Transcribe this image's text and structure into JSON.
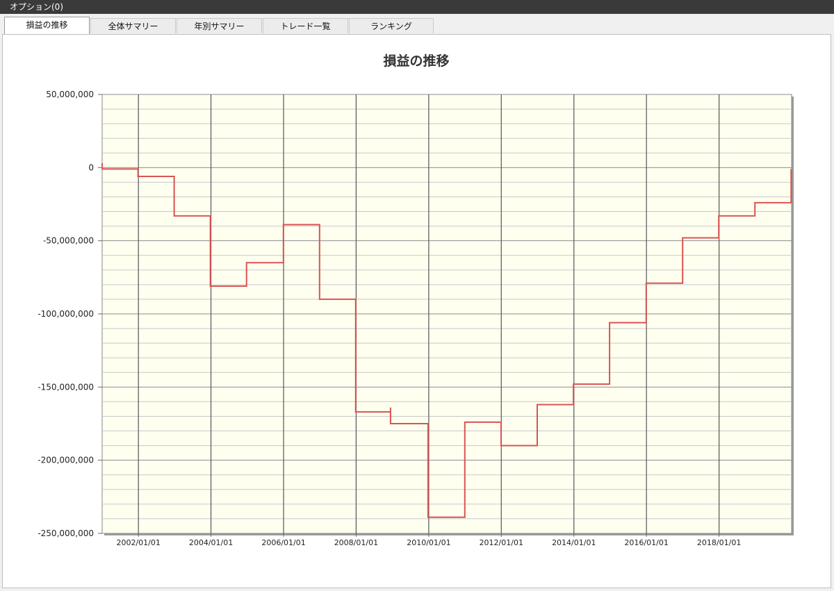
{
  "window": {
    "title": "オプション(0)"
  },
  "tabs": [
    {
      "label": "損益の推移",
      "active": true
    },
    {
      "label": "全体サマリー",
      "active": false
    },
    {
      "label": "年別サマリー",
      "active": false
    },
    {
      "label": "トレード一覧",
      "active": false
    },
    {
      "label": "ランキング",
      "active": false
    }
  ],
  "chart_data": {
    "type": "line",
    "title": "損益の推移",
    "xlabel": "",
    "ylabel": "",
    "line_color": "#d9534f",
    "plot_background": "#fffff0",
    "grid": true,
    "ylim": [
      -250000000,
      50000000
    ],
    "xlim": [
      "2001/01/01",
      "2020/01/01"
    ],
    "y_ticks": [
      50000000,
      0,
      -50000000,
      -100000000,
      -150000000,
      -200000000,
      -250000000
    ],
    "y_tick_labels": [
      "50,000,000",
      "0",
      "-50,000,000",
      "-100,000,000",
      "-150,000,000",
      "-200,000,000",
      "-250,000,000"
    ],
    "x_tick_labels": [
      "2002/01/01",
      "2004/01/01",
      "2006/01/01",
      "2008/01/01",
      "2010/01/01",
      "2012/01/01",
      "2014/01/01",
      "2016/01/01",
      "2018/01/01"
    ],
    "series": [
      {
        "points": [
          [
            "2001/01/01",
            3000000
          ],
          [
            "2001/01/02",
            -1000000
          ],
          [
            "2001/12/28",
            -1000000
          ],
          [
            "2001/12/28",
            -6000000
          ],
          [
            "2002/12/27",
            -6000000
          ],
          [
            "2002/12/27",
            -33000000
          ],
          [
            "2003/12/26",
            -33000000
          ],
          [
            "2003/12/26",
            -81000000
          ],
          [
            "2004/12/24",
            -81000000
          ],
          [
            "2004/12/24",
            -65000000
          ],
          [
            "2005/12/30",
            -65000000
          ],
          [
            "2005/12/30",
            -39000000
          ],
          [
            "2006/12/29",
            -39000000
          ],
          [
            "2006/12/29",
            -90000000
          ],
          [
            "2007/12/28",
            -90000000
          ],
          [
            "2007/12/28",
            -167000000
          ],
          [
            "2008/12/12",
            -167000000
          ],
          [
            "2008/12/12",
            -164000000
          ],
          [
            "2008/12/12",
            -175000000
          ],
          [
            "2009/12/25",
            -175000000
          ],
          [
            "2009/12/25",
            -239000000
          ],
          [
            "2010/12/30",
            -239000000
          ],
          [
            "2010/12/30",
            -174000000
          ],
          [
            "2011/12/30",
            -174000000
          ],
          [
            "2011/12/30",
            -190000000
          ],
          [
            "2012/12/28",
            -190000000
          ],
          [
            "2012/12/28",
            -162000000
          ],
          [
            "2013/12/27",
            -162000000
          ],
          [
            "2013/12/27",
            -148000000
          ],
          [
            "2014/12/26",
            -148000000
          ],
          [
            "2014/12/26",
            -106000000
          ],
          [
            "2015/12/30",
            -106000000
          ],
          [
            "2015/12/30",
            -79000000
          ],
          [
            "2016/12/30",
            -79000000
          ],
          [
            "2016/12/30",
            -48000000
          ],
          [
            "2017/12/29",
            -48000000
          ],
          [
            "2017/12/29",
            -33000000
          ],
          [
            "2018/12/28",
            -33000000
          ],
          [
            "2018/12/28",
            -24000000
          ],
          [
            "2019/12/27",
            -24000000
          ],
          [
            "2019/12/27",
            -1000000
          ]
        ]
      }
    ]
  }
}
